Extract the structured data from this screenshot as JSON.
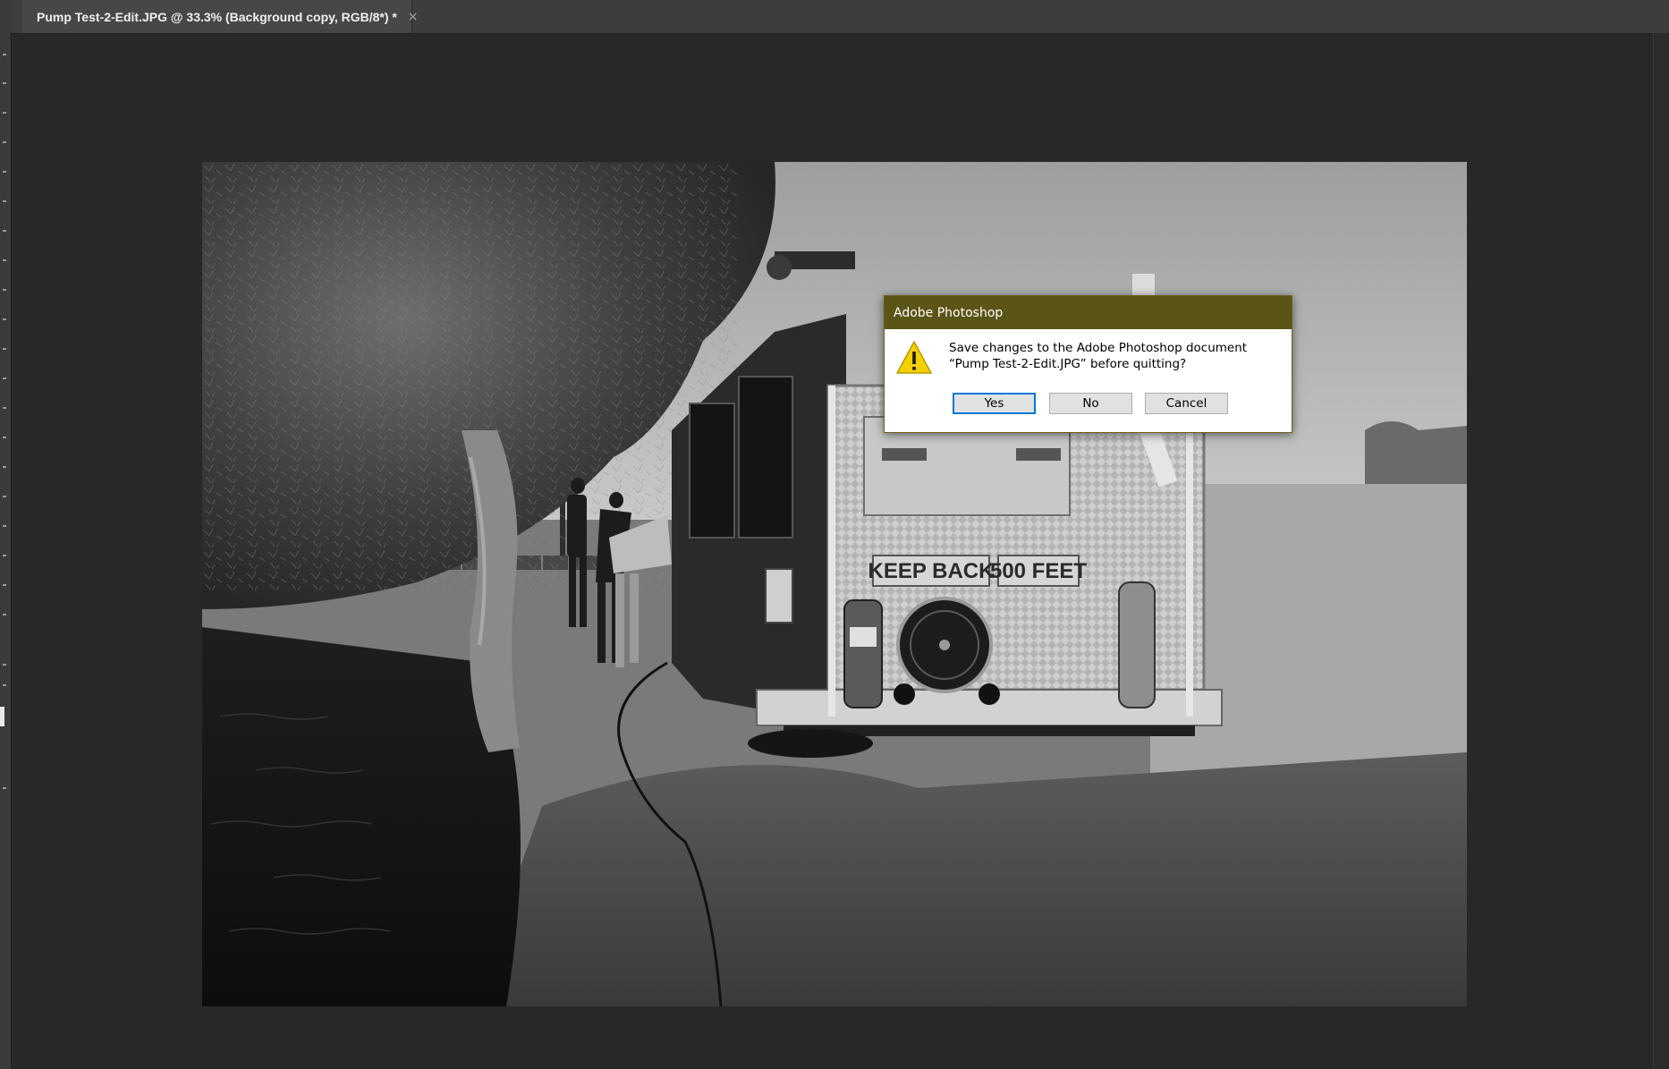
{
  "app": {
    "name": "Adobe Photoshop"
  },
  "tab": {
    "title": "Pump Test-2-Edit.JPG @ 33.3% (Background copy, RGB/8*) *",
    "close_glyph": "×"
  },
  "image": {
    "description_icon": "photo-canvas",
    "signs": [
      "KEEP BACK",
      "500 FEET"
    ]
  },
  "dialog": {
    "title": "Adobe Photoshop",
    "icon": "warning-icon",
    "message_line1": "Save changes to the Adobe Photoshop document",
    "message_line2": "“Pump Test-2-Edit.JPG” before quitting?",
    "buttons": {
      "yes": "Yes",
      "no": "No",
      "cancel": "Cancel"
    },
    "default_button": "yes"
  },
  "colors": {
    "workspace_bg": "#282828",
    "tabbar_bg": "#3d3d3d",
    "dialog_titlebar": "#5c5417",
    "warning_yellow": "#f5d000",
    "default_button_border": "#0078d7"
  }
}
